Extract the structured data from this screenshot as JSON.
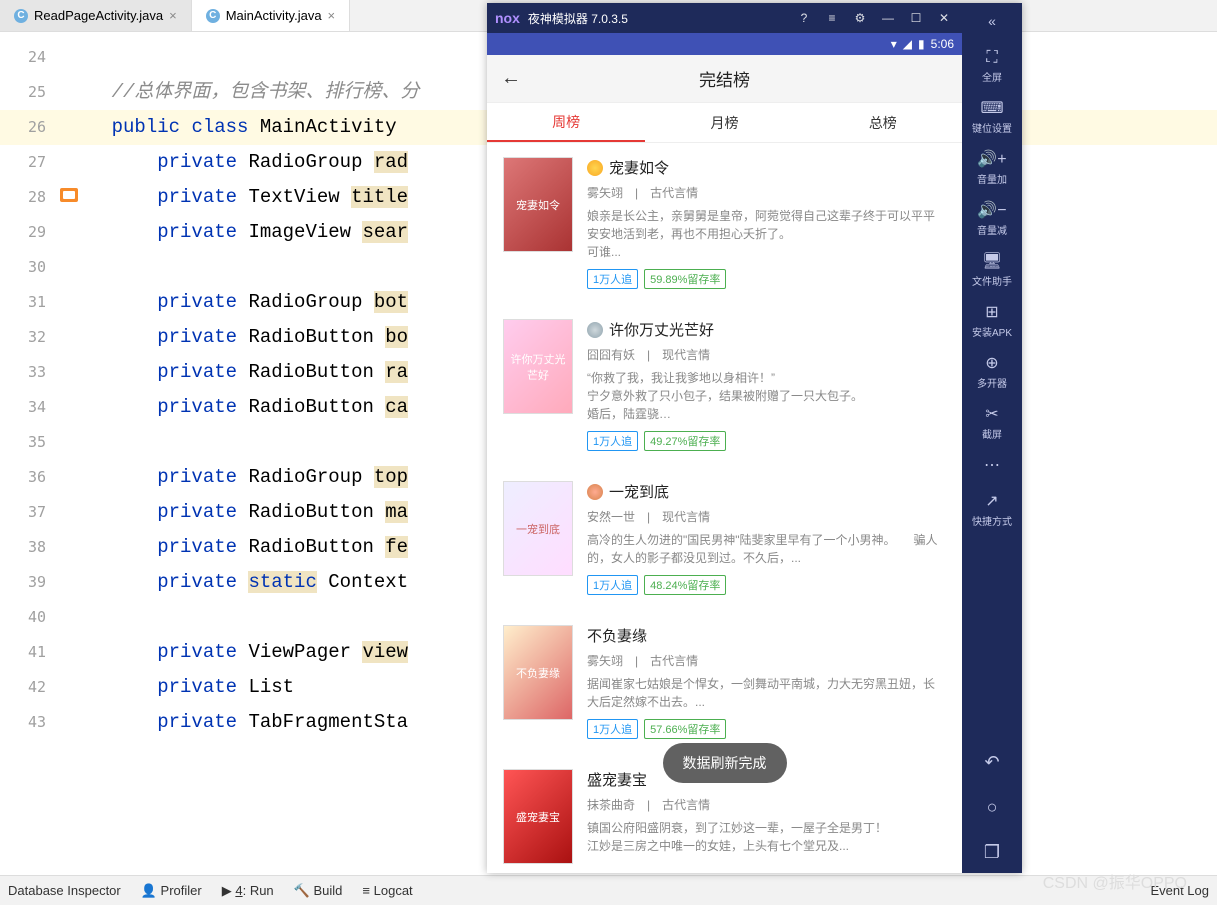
{
  "ide": {
    "tabs": [
      {
        "label": "ReadPageActivity.java",
        "active": false
      },
      {
        "label": "MainActivity.java",
        "active": true
      }
    ],
    "lines": [
      {
        "n": 24,
        "text": ""
      },
      {
        "n": 25,
        "text": "    //总体界面，包含书架、排行榜、分",
        "cls": "cmt"
      },
      {
        "n": 26,
        "text": "    public class MainActivity ",
        "hl": true,
        "tokens": [
          [
            "    ",
            ""
          ],
          [
            "public",
            "kw"
          ],
          [
            " ",
            ""
          ],
          [
            "class",
            "kw"
          ],
          [
            " MainActivity ",
            ""
          ]
        ]
      },
      {
        "n": 27,
        "text": "        private RadioGroup rad",
        "tokens": [
          [
            "        ",
            ""
          ],
          [
            "private",
            "kw"
          ],
          [
            " RadioGroup ",
            ""
          ],
          [
            "rad",
            "warn"
          ]
        ]
      },
      {
        "n": 28,
        "text": "        private TextView title",
        "tokens": [
          [
            "        ",
            ""
          ],
          [
            "private",
            "kw"
          ],
          [
            " TextView ",
            ""
          ],
          [
            "title",
            "warn"
          ]
        ]
      },
      {
        "n": 29,
        "text": "        private ImageView sear",
        "tokens": [
          [
            "        ",
            ""
          ],
          [
            "private",
            "kw"
          ],
          [
            " ImageView ",
            ""
          ],
          [
            "sear",
            "warn"
          ]
        ]
      },
      {
        "n": 30,
        "text": ""
      },
      {
        "n": 31,
        "text": "        private RadioGroup bot",
        "tokens": [
          [
            "        ",
            ""
          ],
          [
            "private",
            "kw"
          ],
          [
            " RadioGroup ",
            ""
          ],
          [
            "bot",
            "warn"
          ]
        ]
      },
      {
        "n": 32,
        "text": "        private RadioButton bo",
        "tokens": [
          [
            "        ",
            ""
          ],
          [
            "private",
            "kw"
          ],
          [
            " RadioButton ",
            ""
          ],
          [
            "bo",
            "warn"
          ]
        ]
      },
      {
        "n": 33,
        "text": "        private RadioButton ra",
        "tokens": [
          [
            "        ",
            ""
          ],
          [
            "private",
            "kw"
          ],
          [
            " RadioButton ",
            ""
          ],
          [
            "ra",
            "warn"
          ]
        ]
      },
      {
        "n": 34,
        "text": "        private RadioButton ca",
        "tokens": [
          [
            "        ",
            ""
          ],
          [
            "private",
            "kw"
          ],
          [
            " RadioButton ",
            ""
          ],
          [
            "ca",
            "warn"
          ]
        ]
      },
      {
        "n": 35,
        "text": ""
      },
      {
        "n": 36,
        "text": "        private RadioGroup top",
        "tokens": [
          [
            "        ",
            ""
          ],
          [
            "private",
            "kw"
          ],
          [
            " RadioGroup ",
            ""
          ],
          [
            "top",
            "warn"
          ]
        ]
      },
      {
        "n": 37,
        "text": "        private RadioButton ma",
        "tokens": [
          [
            "        ",
            ""
          ],
          [
            "private",
            "kw"
          ],
          [
            " RadioButton ",
            ""
          ],
          [
            "ma",
            "warn"
          ]
        ]
      },
      {
        "n": 38,
        "text": "        private RadioButton fe",
        "tokens": [
          [
            "        ",
            ""
          ],
          [
            "private",
            "kw"
          ],
          [
            " RadioButton ",
            ""
          ],
          [
            "fe",
            "warn"
          ]
        ]
      },
      {
        "n": 39,
        "text": "        private static Context",
        "tokens": [
          [
            "        ",
            ""
          ],
          [
            "private",
            "kw"
          ],
          [
            " ",
            ""
          ],
          [
            "static",
            "kw warn"
          ],
          [
            " Context",
            ""
          ]
        ]
      },
      {
        "n": 40,
        "text": ""
      },
      {
        "n": 41,
        "text": "        private ViewPager view",
        "tokens": [
          [
            "        ",
            ""
          ],
          [
            "private",
            "kw"
          ],
          [
            " ViewPager ",
            ""
          ],
          [
            "view",
            "warn"
          ]
        ]
      },
      {
        "n": 42,
        "text": "        private List<Fragment>",
        "tokens": [
          [
            "        ",
            ""
          ],
          [
            "private",
            "kw"
          ],
          [
            " List<Fragment>",
            ""
          ]
        ]
      },
      {
        "n": 43,
        "text": "        private TabFragmentSta",
        "tokens": [
          [
            "        ",
            ""
          ],
          [
            "private",
            "kw"
          ],
          [
            " TabFragmentSta",
            ""
          ]
        ]
      }
    ],
    "status": {
      "items": [
        "Database Inspector",
        "Profiler",
        "4: Run",
        "Build",
        "Logcat"
      ],
      "right": "Event Log",
      "runPrefix": "▶",
      "buildPrefix": "🔨",
      "logcatPrefix": "≡"
    },
    "watermark": "CSDN @振华OPPO"
  },
  "emu": {
    "titlebar": {
      "brand": "nox",
      "title": "夜神模拟器 7.0.3.5",
      "icons": [
        "?",
        "≡",
        "⚙",
        "—",
        "☐",
        "✕"
      ]
    },
    "android": {
      "time": "5:06",
      "wifi": "▾",
      "batt": "▮"
    },
    "app": {
      "title": "完结榜",
      "tabs": [
        "周榜",
        "月榜",
        "总榜"
      ],
      "toast": "数据刷新完成",
      "books": [
        {
          "rank": 1,
          "title": "宠妻如令",
          "author": "雾矢翊",
          "genre": "古代言情",
          "desc": "娘亲是长公主，亲舅舅是皇帝，阿菀觉得自己这辈子终于可以平平安安地活到老，再也不用担心夭折了。\n可谁...",
          "follow": "1万人追",
          "retain": "59.89%留存率",
          "cover": "宠妻如令"
        },
        {
          "rank": 2,
          "title": "许你万丈光芒好",
          "author": "囧囧有妖",
          "genre": "现代言情",
          "desc": "“你救了我，我让我爹地以身相许！”\n宁夕意外救了只小包子，结果被附赠了一只大包子。\n婚后，陆霆骁…",
          "follow": "1万人追",
          "retain": "49.27%留存率",
          "cover": "许你万丈光芒好"
        },
        {
          "rank": 3,
          "title": "一宠到底",
          "author": "安然一世",
          "genre": "现代言情",
          "desc": "高冷的生人勿进的\"国民男神\"陆斐家里早有了一个小男神。　　骗人的，女人的影子都没见到过。不久后，...",
          "follow": "1万人追",
          "retain": "48.24%留存率",
          "cover": "一宠到底"
        },
        {
          "rank": 0,
          "title": "不负妻缘",
          "author": "雾矢翊",
          "genre": "古代言情",
          "desc": "据闻崔家七姑娘是个悍女，一剑舞动平南城，力大无穷黑丑妞，长大后定然嫁不出去。...",
          "follow": "1万人追",
          "retain": "57.66%留存率",
          "cover": "不负妻缘"
        },
        {
          "rank": 0,
          "title": "盛宠妻宝",
          "author": "抹茶曲奇",
          "genre": "古代言情",
          "desc": "镇国公府阳盛阴衰，到了江妙这一辈，一屋子全是男丁！\n江妙是三房之中唯一的女娃，上头有七个堂兄及...",
          "follow": "",
          "retain": "",
          "cover": "盛宠妻宝"
        }
      ]
    },
    "sidebar": {
      "collapse": "«",
      "items": [
        {
          "icon": "⛶",
          "label": "全屏"
        },
        {
          "icon": "⌨",
          "label": "键位设置"
        },
        {
          "icon": "🔊+",
          "label": "音量加"
        },
        {
          "icon": "🔊−",
          "label": "音量减"
        },
        {
          "icon": "🖥",
          "label": "文件助手"
        },
        {
          "icon": "⊞",
          "label": "安装APK"
        },
        {
          "icon": "⊕",
          "label": "多开器"
        },
        {
          "icon": "✂",
          "label": "截屏"
        },
        {
          "icon": "⋯",
          "label": ""
        },
        {
          "icon": "↗",
          "label": "快捷方式"
        }
      ],
      "nav": [
        "↶",
        "○",
        "❐"
      ]
    }
  }
}
